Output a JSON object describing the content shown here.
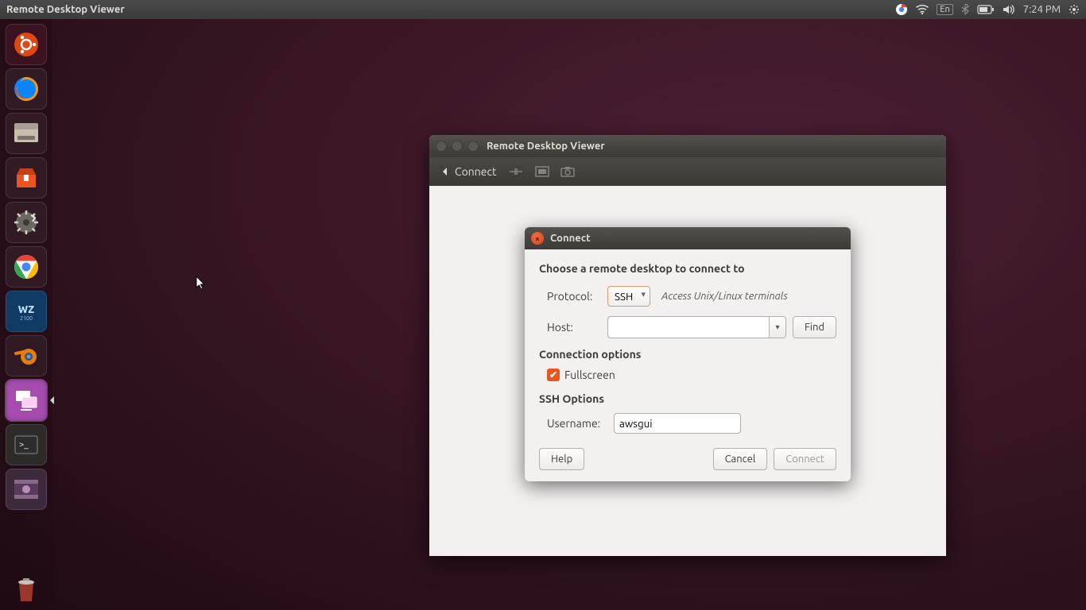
{
  "menubar": {
    "app_title": "Remote Desktop Viewer",
    "lang": "En",
    "time": "7:24 PM"
  },
  "launcher": {
    "items": [
      {
        "name": "ubuntu-dash",
        "color": "#dd4814"
      },
      {
        "name": "firefox",
        "color": "#e66000"
      },
      {
        "name": "files",
        "color": "#a8a39a"
      },
      {
        "name": "software-center",
        "color": "#e95420"
      },
      {
        "name": "settings",
        "color": "#6b6862"
      },
      {
        "name": "chrome",
        "color": "#4285f4"
      },
      {
        "name": "warzone",
        "color": "#1b66b1"
      },
      {
        "name": "blender",
        "color": "#e87d0d"
      },
      {
        "name": "remote-desktop",
        "color": "#a64caf",
        "active": true
      },
      {
        "name": "terminal",
        "color": "#2c2c2c"
      },
      {
        "name": "media-player",
        "color": "#53334f"
      }
    ],
    "trash": "trash"
  },
  "window": {
    "title": "Remote Desktop Viewer",
    "toolbar": {
      "connect": "Connect"
    }
  },
  "dialog": {
    "title": "Connect",
    "heading": "Choose a remote desktop to connect to",
    "protocol_label": "Protocol:",
    "protocol_value": "SSH",
    "protocol_hint": "Access Unix/Linux terminals",
    "host_label": "Host:",
    "host_value": "",
    "find_label": "Find",
    "connopts_title": "Connection options",
    "fullscreen_label": "Fullscreen",
    "fullscreen_checked": true,
    "sshopts_title": "SSH Options",
    "username_label": "Username:",
    "username_value": "awsgui",
    "help_label": "Help",
    "cancel_label": "Cancel",
    "connect_label": "Connect"
  }
}
